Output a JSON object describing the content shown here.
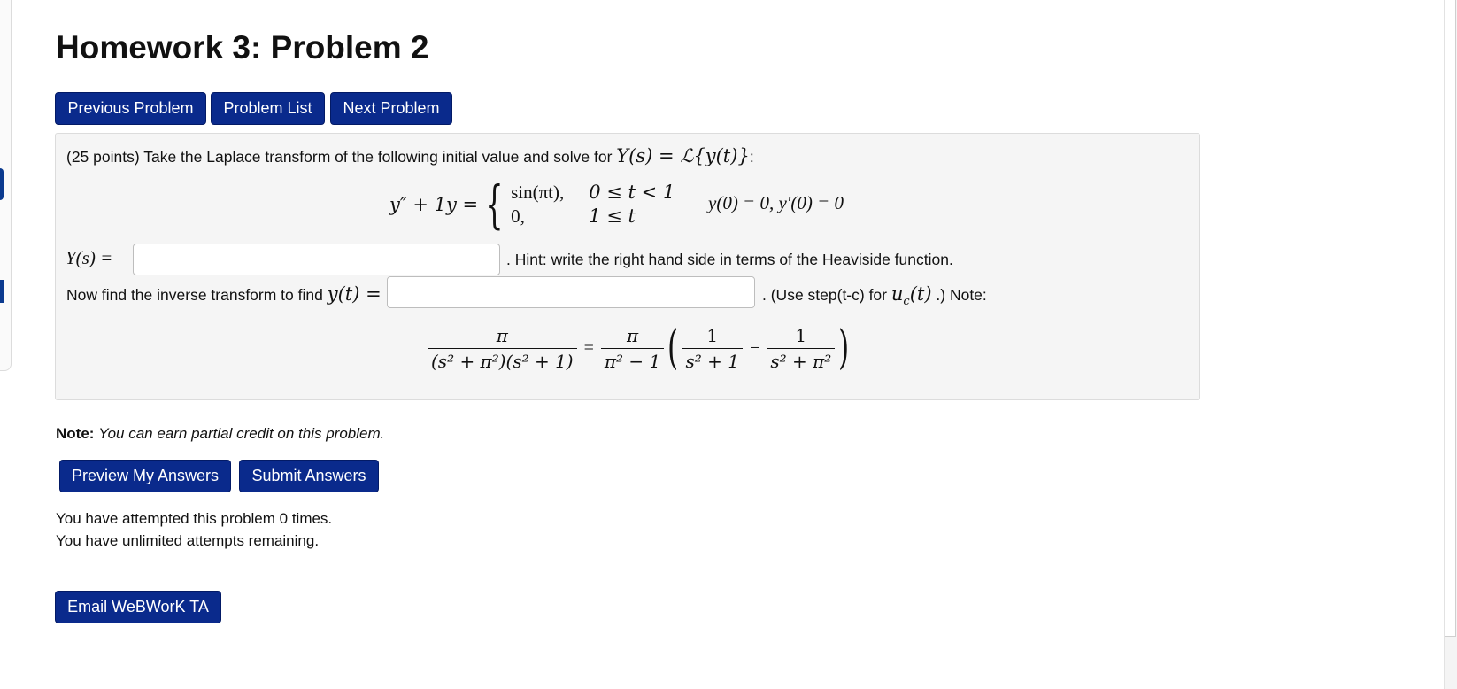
{
  "page": {
    "title": "Homework 3: Problem 2"
  },
  "nav": {
    "previous": "Previous Problem",
    "list": "Problem List",
    "next": "Next Problem"
  },
  "problem": {
    "intro": "(25 points) Take the Laplace transform of the following initial value and solve for",
    "intro_math": "Y(s) = ℒ{y(t)}",
    "intro_end": ":",
    "lhs": "y″ + 1y =",
    "case1_expr": "sin(πt),",
    "case1_cond": "0 ≤ t < 1",
    "case2_expr": "0,",
    "case2_cond": "1 ≤ t",
    "initial_conditions": "y(0) = 0,  y′(0) = 0",
    "ys_label": "Y(s) =",
    "ys_value": "",
    "hint": ". Hint: write the right hand side in terms of the Heaviside function.",
    "inverse_prefix": "Now find the inverse transform to find",
    "inverse_math": "y(t) =",
    "yt_value": "",
    "use_step_prefix": ". (Use step(t-c) for",
    "use_step_math": "u",
    "use_step_sub": "c",
    "use_step_math2": "(t)",
    "use_step_suffix": ".) Note:",
    "note_eq": {
      "lhs_num": "π",
      "lhs_den": "(s² + π²)(s² + 1)",
      "eq": "=",
      "coef_num": "π",
      "coef_den": "π² − 1",
      "f1_num": "1",
      "f1_den": "s² + 1",
      "minus": "−",
      "f2_num": "1",
      "f2_den": "s² + π²"
    }
  },
  "note": {
    "label": "Note:",
    "text": "You can earn partial credit on this problem."
  },
  "actions": {
    "preview": "Preview My Answers",
    "submit": "Submit Answers"
  },
  "attempts": {
    "line1": "You have attempted this problem 0 times.",
    "line2": "You have unlimited attempts remaining."
  },
  "email": {
    "label": "Email WeBWorK TA"
  },
  "colors": {
    "button_bg": "#0a2a8c",
    "panel_bg": "#f5f5f5"
  }
}
